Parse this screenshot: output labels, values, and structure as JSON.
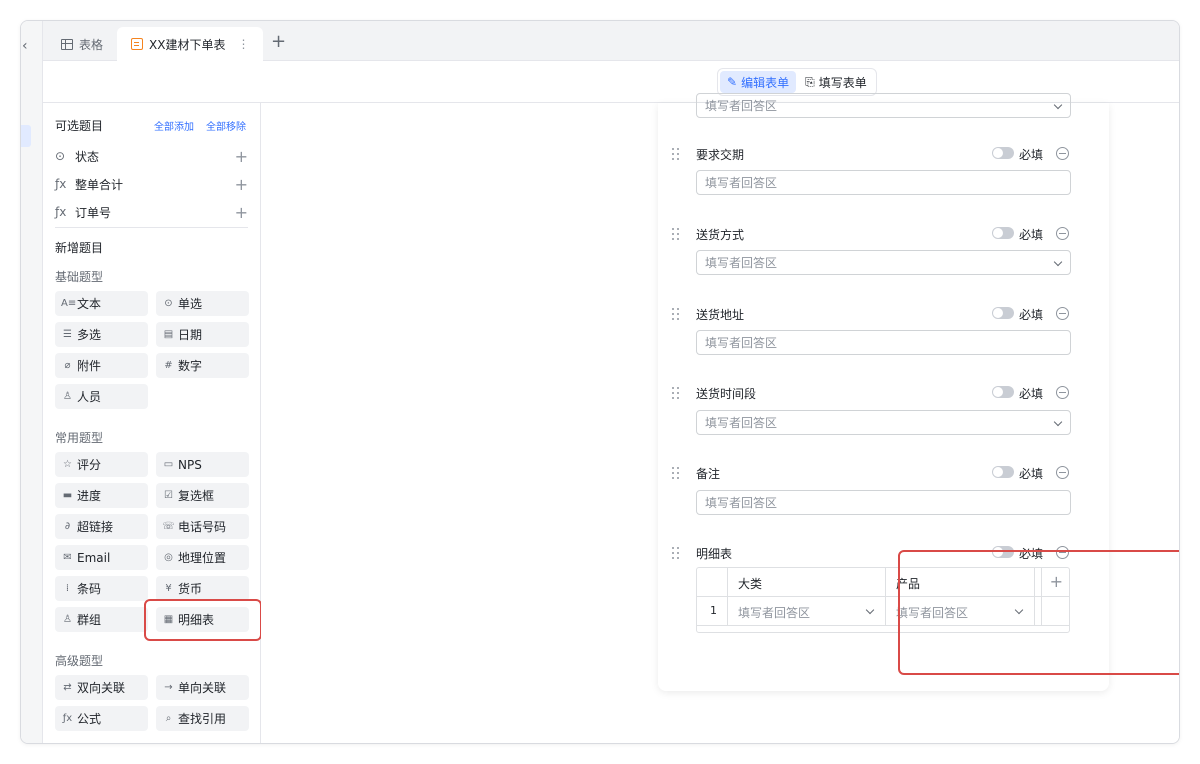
{
  "tabs": [
    {
      "label": "表格",
      "icon": "grid-icon"
    },
    {
      "label": "XX建材下单表",
      "icon": "form-icon",
      "active": true
    }
  ],
  "toolbar": {
    "edit_label": "编辑表单",
    "fill_label": "填写表单"
  },
  "sidebar": {
    "optional_title": "可选题目",
    "add_all": "全部添加",
    "remove_all": "全部移除",
    "optional_fields": [
      {
        "label": "状态",
        "icon": "status-icon"
      },
      {
        "label": "整单合计",
        "icon": "formula-icon"
      },
      {
        "label": "订单号",
        "icon": "formula-icon"
      }
    ],
    "new_title": "新增题目",
    "basic_title": "基础题型",
    "basic": [
      "文本",
      "单选",
      "多选",
      "日期",
      "附件",
      "数字",
      "人员"
    ],
    "common_title": "常用题型",
    "common": [
      "评分",
      "NPS",
      "进度",
      "复选框",
      "超链接",
      "电话号码",
      "Email",
      "地理位置",
      "条码",
      "货币",
      "群组",
      "明细表"
    ],
    "advanced_title": "高级题型",
    "advanced": [
      "双向关联",
      "单向关联",
      "公式",
      "查找引用"
    ]
  },
  "form": {
    "placeholder": "填写者回答区",
    "required_label": "必填",
    "questions": [
      {
        "label": "要求交期",
        "type": "text"
      },
      {
        "label": "送货方式",
        "type": "select"
      },
      {
        "label": "送货地址",
        "type": "text"
      },
      {
        "label": "送货时间段",
        "type": "select"
      },
      {
        "label": "备注",
        "type": "text"
      }
    ],
    "detail": {
      "label": "明细表",
      "columns": [
        "大类",
        "产品"
      ],
      "row_number": "1"
    }
  },
  "colors": {
    "accent": "#3370ff",
    "highlight": "#d94a47"
  }
}
